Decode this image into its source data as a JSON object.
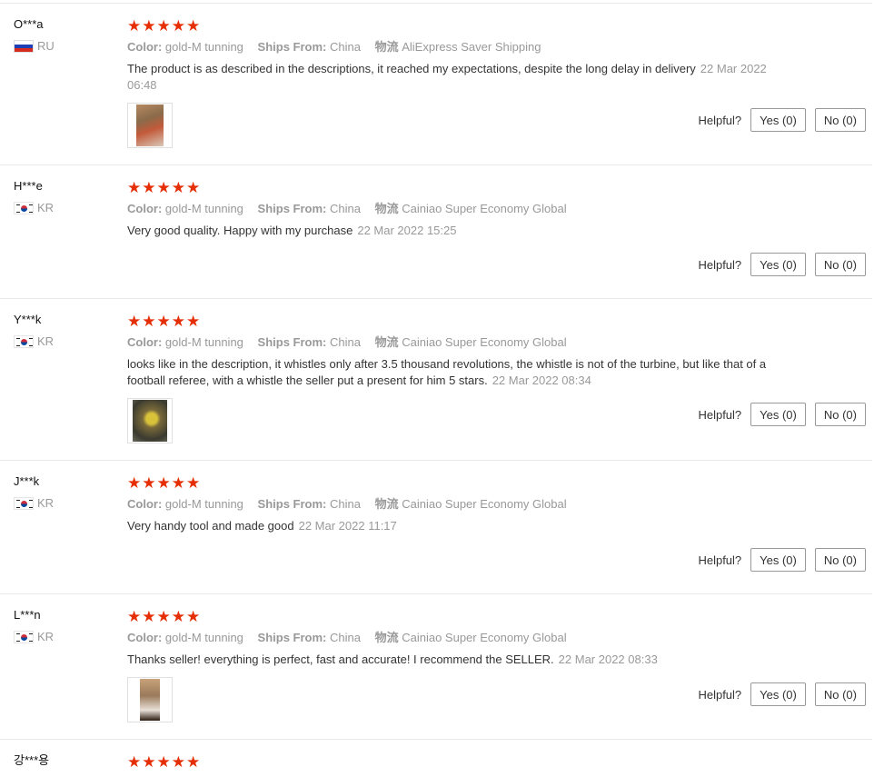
{
  "labels": {
    "color": "Color:",
    "ships_from": "Ships From:",
    "shipping_method": "物流",
    "helpful": "Helpful?"
  },
  "star_glyph": "★",
  "reviews": [
    {
      "user": "O***a",
      "country": "RU",
      "flag": "ru",
      "rating": 5,
      "color": "gold-M tunning",
      "ships_from": "China",
      "shipping": "AliExpress Saver Shipping",
      "text": "The product is as described in the descriptions, it reached my expectations, despite the long delay in delivery",
      "date": "22 Mar 2022 06:48",
      "has_photo": true,
      "yes": "Yes (0)",
      "no": "No (0)"
    },
    {
      "user": "H***e",
      "country": "KR",
      "flag": "kr",
      "rating": 5,
      "color": "gold-M tunning",
      "ships_from": "China",
      "shipping": "Cainiao Super Economy Global",
      "text": "Very good quality. Happy with my purchase",
      "date": "22 Mar 2022 15:25",
      "has_photo": false,
      "yes": "Yes (0)",
      "no": "No (0)"
    },
    {
      "user": "Y***k",
      "country": "KR",
      "flag": "kr",
      "rating": 5,
      "color": "gold-M tunning",
      "ships_from": "China",
      "shipping": "Cainiao Super Economy Global",
      "text": "looks like in the description, it whistles only after 3.5 thousand revolutions, the whistle is not of the turbine, but like that of a football referee, with a whistle the seller put a present for him 5 stars.",
      "date": "22 Mar 2022 08:34",
      "has_photo": true,
      "yes": "Yes (0)",
      "no": "No (0)"
    },
    {
      "user": "J***k",
      "country": "KR",
      "flag": "kr",
      "rating": 5,
      "color": "gold-M tunning",
      "ships_from": "China",
      "shipping": "Cainiao Super Economy Global",
      "text": "Very handy tool and made good",
      "date": "22 Mar 2022 11:17",
      "has_photo": false,
      "yes": "Yes (0)",
      "no": "No (0)"
    },
    {
      "user": "L***n",
      "country": "KR",
      "flag": "kr",
      "rating": 5,
      "color": "gold-M tunning",
      "ships_from": "China",
      "shipping": "Cainiao Super Economy Global",
      "text": "Thanks seller! everything is perfect, fast and accurate! I recommend the SELLER.",
      "date": "22 Mar 2022 08:33",
      "has_photo": true,
      "yes": "Yes (0)",
      "no": "No (0)"
    },
    {
      "user": "강***용",
      "rating": 5
    }
  ]
}
